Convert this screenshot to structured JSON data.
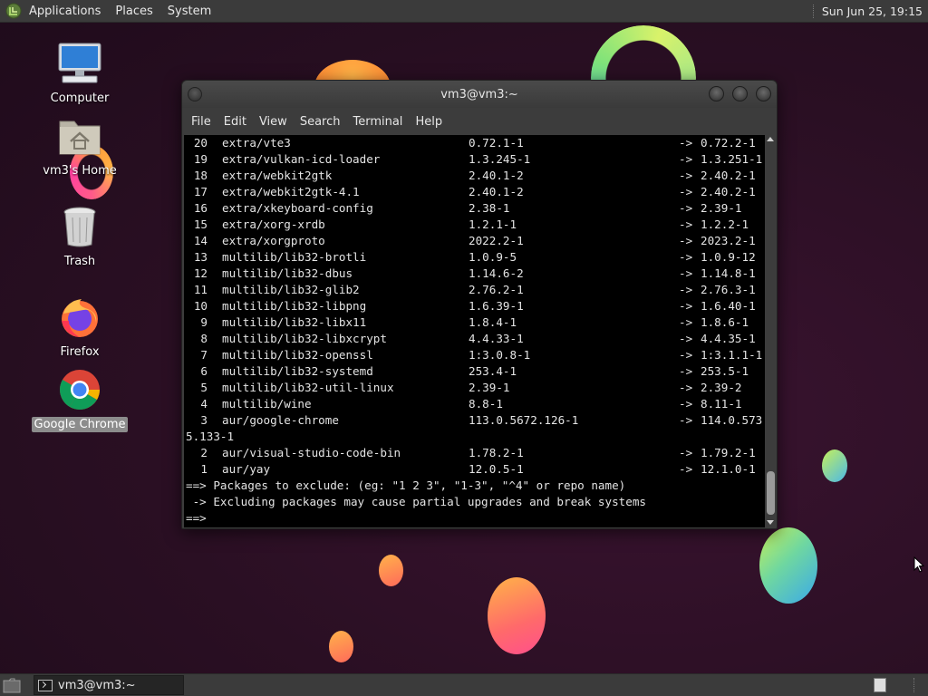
{
  "top_panel": {
    "menus": [
      "Applications",
      "Places",
      "System"
    ],
    "clock": "Sun Jun 25, 19:15"
  },
  "desktop_icons": [
    {
      "label": "Computer",
      "icon": "computer-icon"
    },
    {
      "label": "vm3's Home",
      "icon": "home-folder-icon"
    },
    {
      "label": "Trash",
      "icon": "trash-icon"
    },
    {
      "label": "Firefox",
      "icon": "firefox-icon"
    },
    {
      "label": "Google Chrome",
      "icon": "chrome-icon",
      "selected": true
    }
  ],
  "terminal": {
    "title": "vm3@vm3:~",
    "menu": [
      "File",
      "Edit",
      "View",
      "Search",
      "Terminal",
      "Help"
    ],
    "packages": [
      {
        "num": "20",
        "name": "extra/vte3",
        "old": "0.72.1-1",
        "arrow": "->",
        "new": "0.72.2-1"
      },
      {
        "num": "19",
        "name": "extra/vulkan-icd-loader",
        "old": "1.3.245-1",
        "arrow": "->",
        "new": "1.3.251-1"
      },
      {
        "num": "18",
        "name": "extra/webkit2gtk",
        "old": "2.40.1-2",
        "arrow": "->",
        "new": "2.40.2-1"
      },
      {
        "num": "17",
        "name": "extra/webkit2gtk-4.1",
        "old": "2.40.1-2",
        "arrow": "->",
        "new": "2.40.2-1"
      },
      {
        "num": "16",
        "name": "extra/xkeyboard-config",
        "old": "2.38-1",
        "arrow": "->",
        "new": "2.39-1"
      },
      {
        "num": "15",
        "name": "extra/xorg-xrdb",
        "old": "1.2.1-1",
        "arrow": "->",
        "new": "1.2.2-1"
      },
      {
        "num": "14",
        "name": "extra/xorgproto",
        "old": "2022.2-1",
        "arrow": "->",
        "new": "2023.2-1"
      },
      {
        "num": "13",
        "name": "multilib/lib32-brotli",
        "old": "1.0.9-5",
        "arrow": "->",
        "new": "1.0.9-12"
      },
      {
        "num": "12",
        "name": "multilib/lib32-dbus",
        "old": "1.14.6-2",
        "arrow": "->",
        "new": "1.14.8-1"
      },
      {
        "num": "11",
        "name": "multilib/lib32-glib2",
        "old": "2.76.2-1",
        "arrow": "->",
        "new": "2.76.3-1"
      },
      {
        "num": "10",
        "name": "multilib/lib32-libpng",
        "old": "1.6.39-1",
        "arrow": "->",
        "new": "1.6.40-1"
      },
      {
        "num": "9",
        "name": "multilib/lib32-libx11",
        "old": "1.8.4-1",
        "arrow": "->",
        "new": "1.8.6-1"
      },
      {
        "num": "8",
        "name": "multilib/lib32-libxcrypt",
        "old": "4.4.33-1",
        "arrow": "->",
        "new": "4.4.35-1"
      },
      {
        "num": "7",
        "name": "multilib/lib32-openssl",
        "old": "1:3.0.8-1",
        "arrow": "->",
        "new": "1:3.1.1-1"
      },
      {
        "num": "6",
        "name": "multilib/lib32-systemd",
        "old": "253.4-1",
        "arrow": "->",
        "new": "253.5-1"
      },
      {
        "num": "5",
        "name": "multilib/lib32-util-linux",
        "old": "2.39-1",
        "arrow": "->",
        "new": "2.39-2"
      },
      {
        "num": "4",
        "name": "multilib/wine",
        "old": "8.8-1",
        "arrow": "->",
        "new": "8.11-1"
      },
      {
        "num": "3",
        "name": "aur/google-chrome",
        "old": "113.0.5672.126-1",
        "arrow": "->",
        "new": "114.0.573",
        "wrap": "5.133-1"
      },
      {
        "num": "2",
        "name": "aur/visual-studio-code-bin",
        "old": "1.78.2-1",
        "arrow": "->",
        "new": "1.79.2-1"
      },
      {
        "num": "1",
        "name": "aur/yay",
        "old": "12.0.5-1",
        "arrow": "->",
        "new": "12.1.0-1"
      }
    ],
    "prompt_lines": [
      "==> Packages to exclude: (eg: \"1 2 3\", \"1-3\", \"^4\" or repo name)",
      " -> Excluding packages may cause partial upgrades and break systems",
      "==> "
    ]
  },
  "bottom_panel": {
    "task_label": "vm3@vm3:~"
  }
}
